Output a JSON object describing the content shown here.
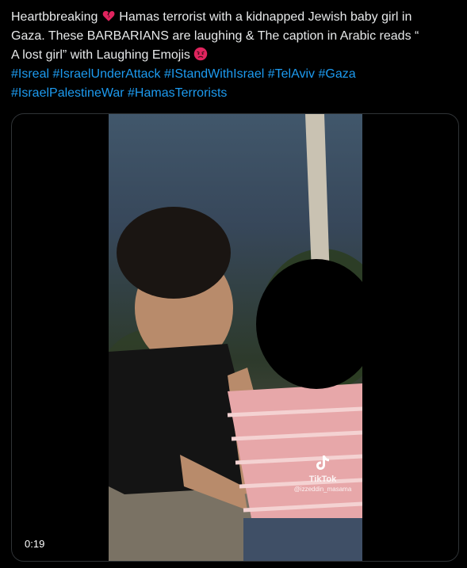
{
  "tweet": {
    "line1_before_emoji": "Heartbbreaking ",
    "line1_after_emoji": " Hamas terrorist with a kidnapped Jewish baby girl in",
    "line2": "Gaza.   These BARBARIANS are laughing & The caption in Arabic reads “",
    "line3": "A lost girl” with Laughing Emojis ",
    "emojis": [
      "broken-heart-icon",
      "angry-face-icon"
    ],
    "hashtags_line1": [
      "#Isreal",
      "#IsraelUnderAttack",
      "#IStandWithIsrael",
      "#TelAviv",
      "#Gaza"
    ],
    "hashtags_line2": [
      "#IsraelPalestineWar",
      "#HamasTerrorists"
    ]
  },
  "media": {
    "duration": "0:19",
    "watermark_brand": "TikTok",
    "watermark_handle": "@izzeddin_masama"
  },
  "colors": {
    "background": "#000000",
    "text": "#e7e9ea",
    "hashtag": "#1d9bf0",
    "card_border": "#2f3336"
  }
}
